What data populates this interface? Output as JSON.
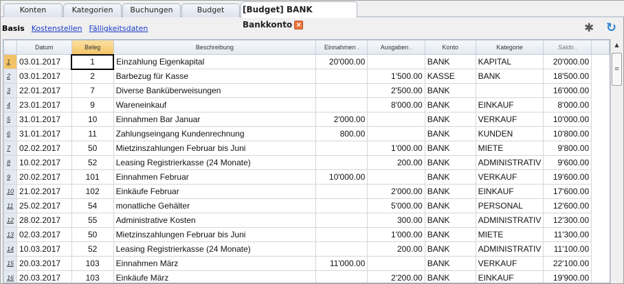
{
  "tabs": [
    "Konten",
    "Kategorien",
    "Buchungen",
    "Budget"
  ],
  "active_tab": "[Budget] BANK Bankkonto",
  "close_glyph": "×",
  "subtabs": {
    "active": "Basis",
    "links": [
      "Kostenstellen",
      "Fälligkeitsdaten"
    ]
  },
  "icons": {
    "gear": "✱",
    "refresh": "↻"
  },
  "columns": [
    "Datum",
    "Beleg",
    "Beschreibung",
    "Einnahmen .",
    "Ausgaben .",
    "Konto",
    "Kategorie",
    "Saldo ."
  ],
  "rows": [
    [
      "1",
      "03.01.2017",
      "1",
      "Einzahlung Eigenkapital",
      "20'000.00",
      "",
      "BANK",
      "KAPITAL",
      "20'000.00"
    ],
    [
      "2",
      "03.01.2017",
      "2",
      "Barbezug für Kasse",
      "",
      "1'500.00",
      "KASSE",
      "BANK",
      "18'500.00"
    ],
    [
      "3",
      "22.01.2017",
      "7",
      "Diverse Banküberweisungen",
      "",
      "2'500.00",
      "BANK",
      "",
      "16'000.00"
    ],
    [
      "4",
      "23.01.2017",
      "9",
      "Wareneinkauf",
      "",
      "8'000.00",
      "BANK",
      "EINKAUF",
      "8'000.00"
    ],
    [
      "5",
      "31.01.2017",
      "10",
      "Einnahmen Bar Januar",
      "2'000.00",
      "",
      "BANK",
      "VERKAUF",
      "10'000.00"
    ],
    [
      "6",
      "31.01.2017",
      "11",
      "Zahlungseingang Kundenrechnung",
      "800.00",
      "",
      "BANK",
      "KUNDEN",
      "10'800.00"
    ],
    [
      "7",
      "02.02.2017",
      "50",
      "Mietzinszahlungen Februar bis Juni",
      "",
      "1'000.00",
      "BANK",
      "MIETE",
      "9'800.00"
    ],
    [
      "8",
      "10.02.2017",
      "52",
      "Leasing Registrierkasse (24 Monate)",
      "",
      "200.00",
      "BANK",
      "ADMINISTRATIV",
      "9'600.00"
    ],
    [
      "9",
      "20.02.2017",
      "101",
      "Einnahmen Februar",
      "10'000.00",
      "",
      "BANK",
      "VERKAUF",
      "19'600.00"
    ],
    [
      "10",
      "21.02.2017",
      "102",
      "Einkäufe Februar",
      "",
      "2'000.00",
      "BANK",
      "EINKAUF",
      "17'600.00"
    ],
    [
      "11",
      "25.02.2017",
      "54",
      "monatliche Gehälter",
      "",
      "5'000.00",
      "BANK",
      "PERSONAL",
      "12'600.00"
    ],
    [
      "12",
      "28.02.2017",
      "55",
      "Administrative Kosten",
      "",
      "300.00",
      "BANK",
      "ADMINISTRATIV",
      "12'300.00"
    ],
    [
      "13",
      "02.03.2017",
      "50",
      "Mietzinszahlungen Februar bis Juni",
      "",
      "1'000.00",
      "BANK",
      "MIETE",
      "11'300.00"
    ],
    [
      "14",
      "10.03.2017",
      "52",
      "Leasing Registrierkasse (24 Monate)",
      "",
      "200.00",
      "BANK",
      "ADMINISTRATIV",
      "11'100.00"
    ],
    [
      "15",
      "20.03.2017",
      "103",
      "Einnahmen März",
      "11'000.00",
      "",
      "BANK",
      "VERKAUF",
      "22'100.00"
    ],
    [
      "16",
      "20.03.2017",
      "103",
      "Einkäufe März",
      "",
      "2'200.00",
      "BANK",
      "EINKAUF",
      "19'900.00"
    ]
  ]
}
